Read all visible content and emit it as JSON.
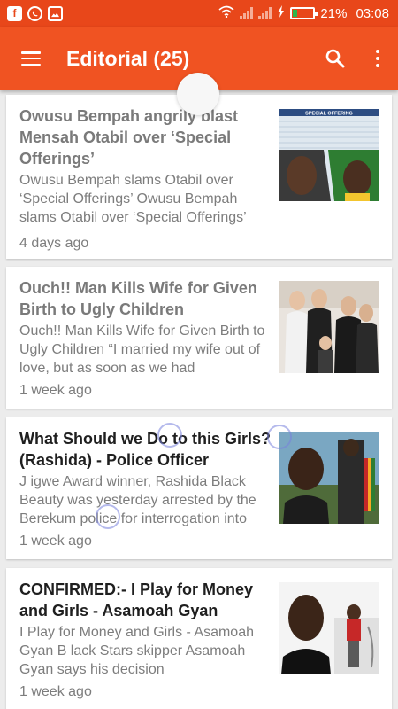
{
  "status_bar": {
    "battery": "21%",
    "time": "03:08",
    "notification_icons": [
      "facebook-icon",
      "whatsapp-icon",
      "image-icon"
    ],
    "battery_color": "#2fb64c"
  },
  "toolbar": {
    "title": "Editorial (25)",
    "background": "#f05322"
  },
  "articles": [
    {
      "title": "Owusu Bempah angrily blast Mensah Otabil over ‘Special Offerings’",
      "snippet": "Owusu Bempah slams Otabil over ‘Special Offerings’ Owusu Bempah slams Otabil over ‘Special Offerings’",
      "time": "4 days ago",
      "thumb_caption": "SPECIAL OFFERING",
      "read": true
    },
    {
      "title": "Ouch!! Man Kills Wife for Given Birth to Ugly Children",
      "snippet": "Ouch!! Man Kills Wife for Given Birth to Ugly Children “I married my wife out of love, but as soon as we had",
      "time": "1 week ago",
      "read": true
    },
    {
      "title": "What Should we Do to this Girls?  (Rashida) - Police Officer",
      "snippet": "J igwe Award winner, Rashida Black Beauty was yesterday arrested by the Berekum police for interrogation into",
      "time": "1 week ago",
      "read": false
    },
    {
      "title": "CONFIRMED:-  I  Play for Money and  Girls - Asamoah Gyan",
      "snippet": "I  Play for Money and  Girls - Asamoah Gyan B lack Stars skipper Asamoah Gyan says his decision",
      "time": "1 week ago",
      "read": false
    }
  ]
}
